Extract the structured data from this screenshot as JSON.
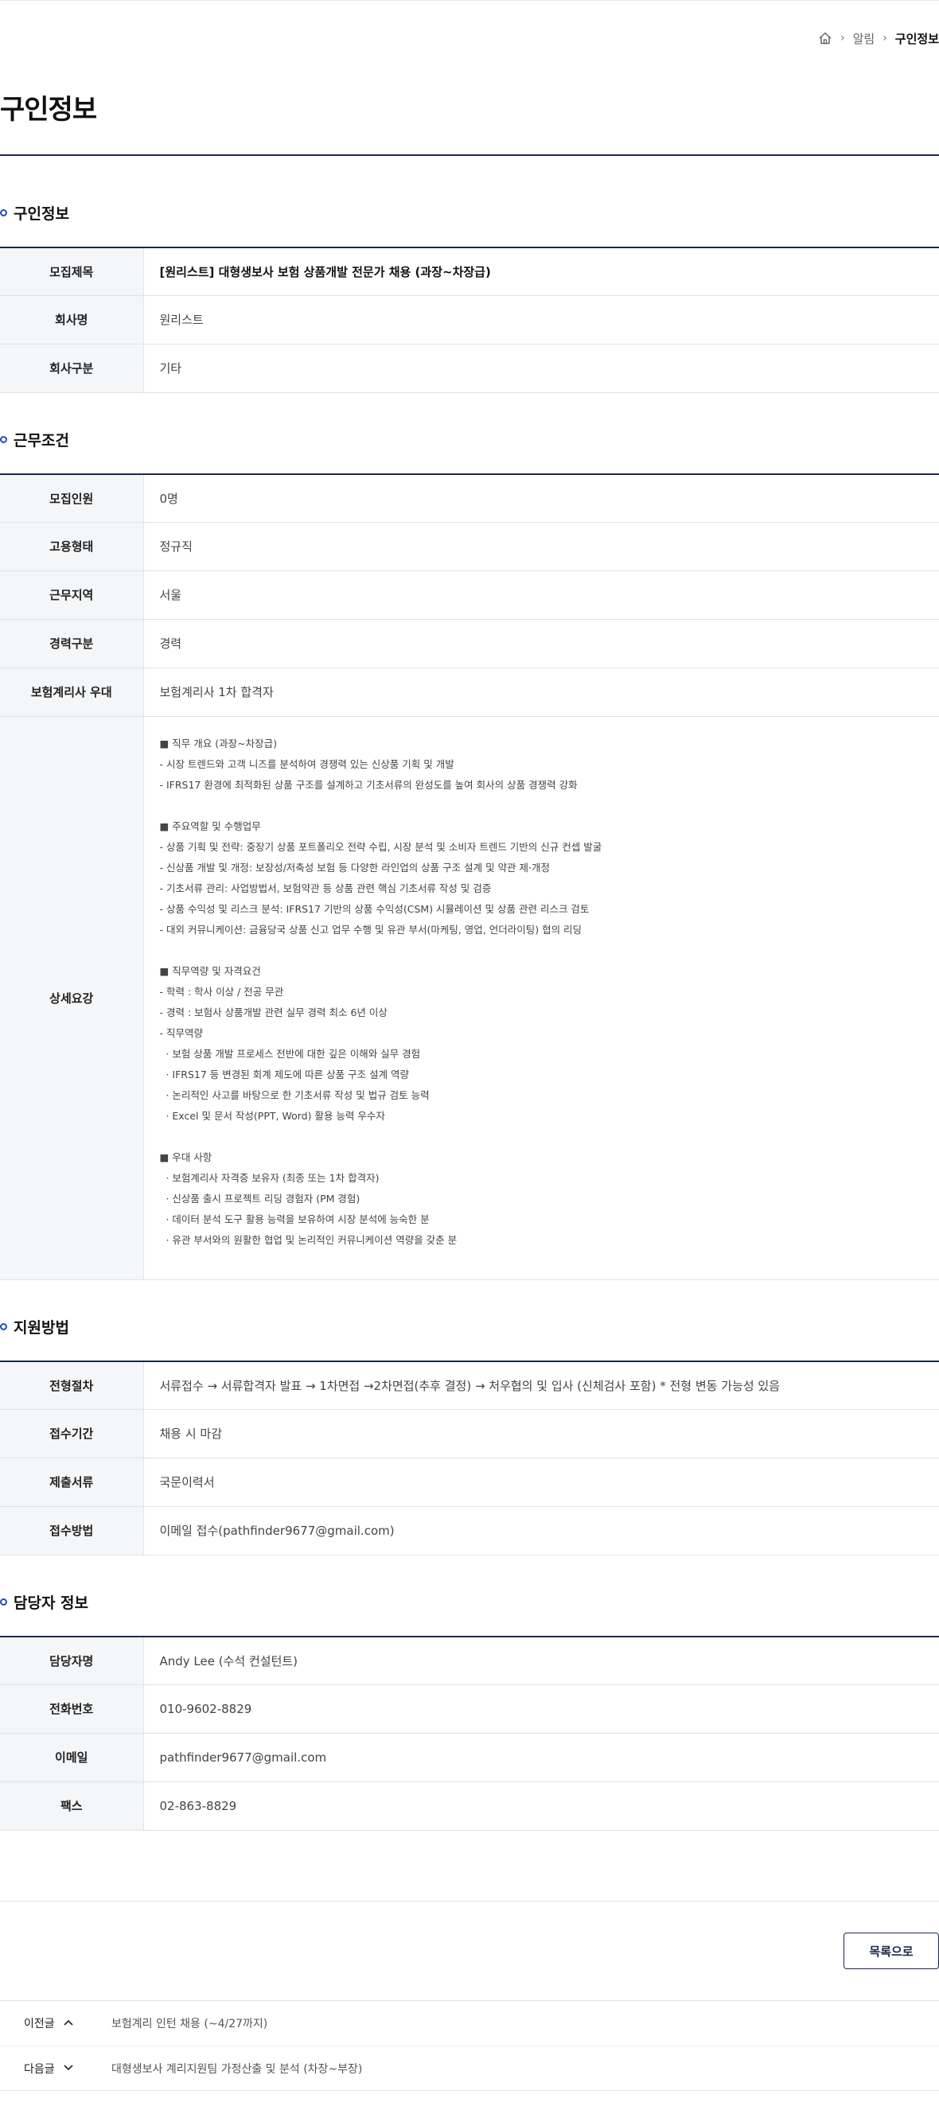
{
  "breadcrumb": {
    "level1": "알림",
    "current": "구인정보"
  },
  "page_title": "구인정보",
  "job_info": {
    "heading": "구인정보",
    "rows": [
      {
        "label": "모집제목",
        "value": "[원리스트] 대형생보사 보험 상품개발 전문가 채용 (과장~차장급)"
      },
      {
        "label": "회사명",
        "value": "원리스트"
      },
      {
        "label": "회사구분",
        "value": "기타"
      }
    ]
  },
  "conditions": {
    "heading": "근무조건",
    "rows": [
      {
        "label": "모집인원",
        "value": "0명"
      },
      {
        "label": "고용형태",
        "value": "정규직"
      },
      {
        "label": "근무지역",
        "value": "서울"
      },
      {
        "label": "경력구분",
        "value": "경력"
      },
      {
        "label": "보험계리사 우대",
        "value": "보험계리사 1차 합격자"
      }
    ],
    "detail_label": "상세요강",
    "detail_lines": [
      "■ 직무 개요 (과장~차장급)",
      "- 시장 트렌드와 고객 니즈를 분석하여 경쟁력 있는 신상품 기획 및 개발",
      "- IFRS17 환경에 최적화된 상품 구조를 설계하고 기초서류의 완성도를 높여 회사의 상품 경쟁력 강화",
      "",
      "■ 주요역할 및 수행업무",
      "- 상품 기획 및 전략: 중장기 상품 포트폴리오 전략 수립, 시장 분석 및 소비자 트렌드 기반의 신규 컨셉 발굴",
      "- 신상품 개발 및 개정: 보장성/저축성 보험 등 다양한 라인업의 상품 구조 설계 및 약관 제·개정",
      "- 기초서류 관리: 사업방법서, 보험약관 등 상품 관련 핵심 기초서류 작성 및 검증",
      "- 상품 수익성 및 리스크 분석: IFRS17 기반의 상품 수익성(CSM) 시뮬레이션 및 상품 관련 리스크 검토",
      "- 대외 커뮤니케이션: 금융당국 상품 신고 업무 수행 및 유관 부서(마케팅, 영업, 언더라이팅) 협의 리딩",
      "",
      "■ 직무역량 및 자격요건",
      "- 학력 : 학사 이상 / 전공 무관",
      "- 경력 : 보험사 상품개발 관련 실무 경력 최소 6년 이상",
      "- 직무역량",
      "  · 보험 상품 개발 프로세스 전반에 대한 깊은 이해와 실무 경험",
      "  · IFRS17 등 변경된 회계 제도에 따른 상품 구조 설계 역량",
      "  · 논리적인 사고를 바탕으로 한 기초서류 작성 및 법규 검토 능력",
      "  · Excel 및 문서 작성(PPT, Word) 활용 능력 우수자",
      "",
      "■ 우대 사항",
      "  · 보험계리사 자격증 보유자 (최종 또는 1차 합격자)",
      "  · 신상품 출시 프로젝트 리딩 경험자 (PM 경험)",
      "  · 데이터 분석 도구 활용 능력을 보유하여 시장 분석에 능숙한 분",
      "  · 유관 부서와의 원활한 협업 및 논리적인 커뮤니케이션 역량을 갖춘 분"
    ]
  },
  "apply": {
    "heading": "지원방법",
    "rows": [
      {
        "label": "전형절차",
        "value": "서류접수 → 서류합격자 발표 → 1차면접 →2차면접(추후 결정) → 처우협의 및 입사 (신체검사 포함) * 전형 변동 가능성 있음"
      },
      {
        "label": "접수기간",
        "value": "채용 시 마감"
      },
      {
        "label": "제출서류",
        "value": "국문이력서"
      },
      {
        "label": "접수방법",
        "value": "이메일 접수(pathfinder9677@gmail.com)"
      }
    ]
  },
  "contact": {
    "heading": "담당자 정보",
    "rows": [
      {
        "label": "담당자명",
        "value": "Andy Lee (수석 컨설턴트)"
      },
      {
        "label": "전화번호",
        "value": "010-9602-8829"
      },
      {
        "label": "이메일",
        "value": "pathfinder9677@gmail.com"
      },
      {
        "label": "팩스",
        "value": "02-863-8829"
      }
    ]
  },
  "list_button": "목록으로",
  "nav": {
    "prev_label": "이전글",
    "prev_title": "보험계리 인턴 채용 (~4/27까지)",
    "next_label": "다음글",
    "next_title": "대형생보사 계리지원팀 가정산출 및 분석 (차장~부장)"
  },
  "icons": {
    "home": "home-icon",
    "separator": "chevron-right-icon",
    "up": "chevron-up-icon",
    "down": "chevron-down-icon"
  },
  "colors": {
    "navy": "#1b2a4a",
    "accent_blue": "#1f4fb5",
    "header_cell_bg": "#f5f6f8"
  }
}
